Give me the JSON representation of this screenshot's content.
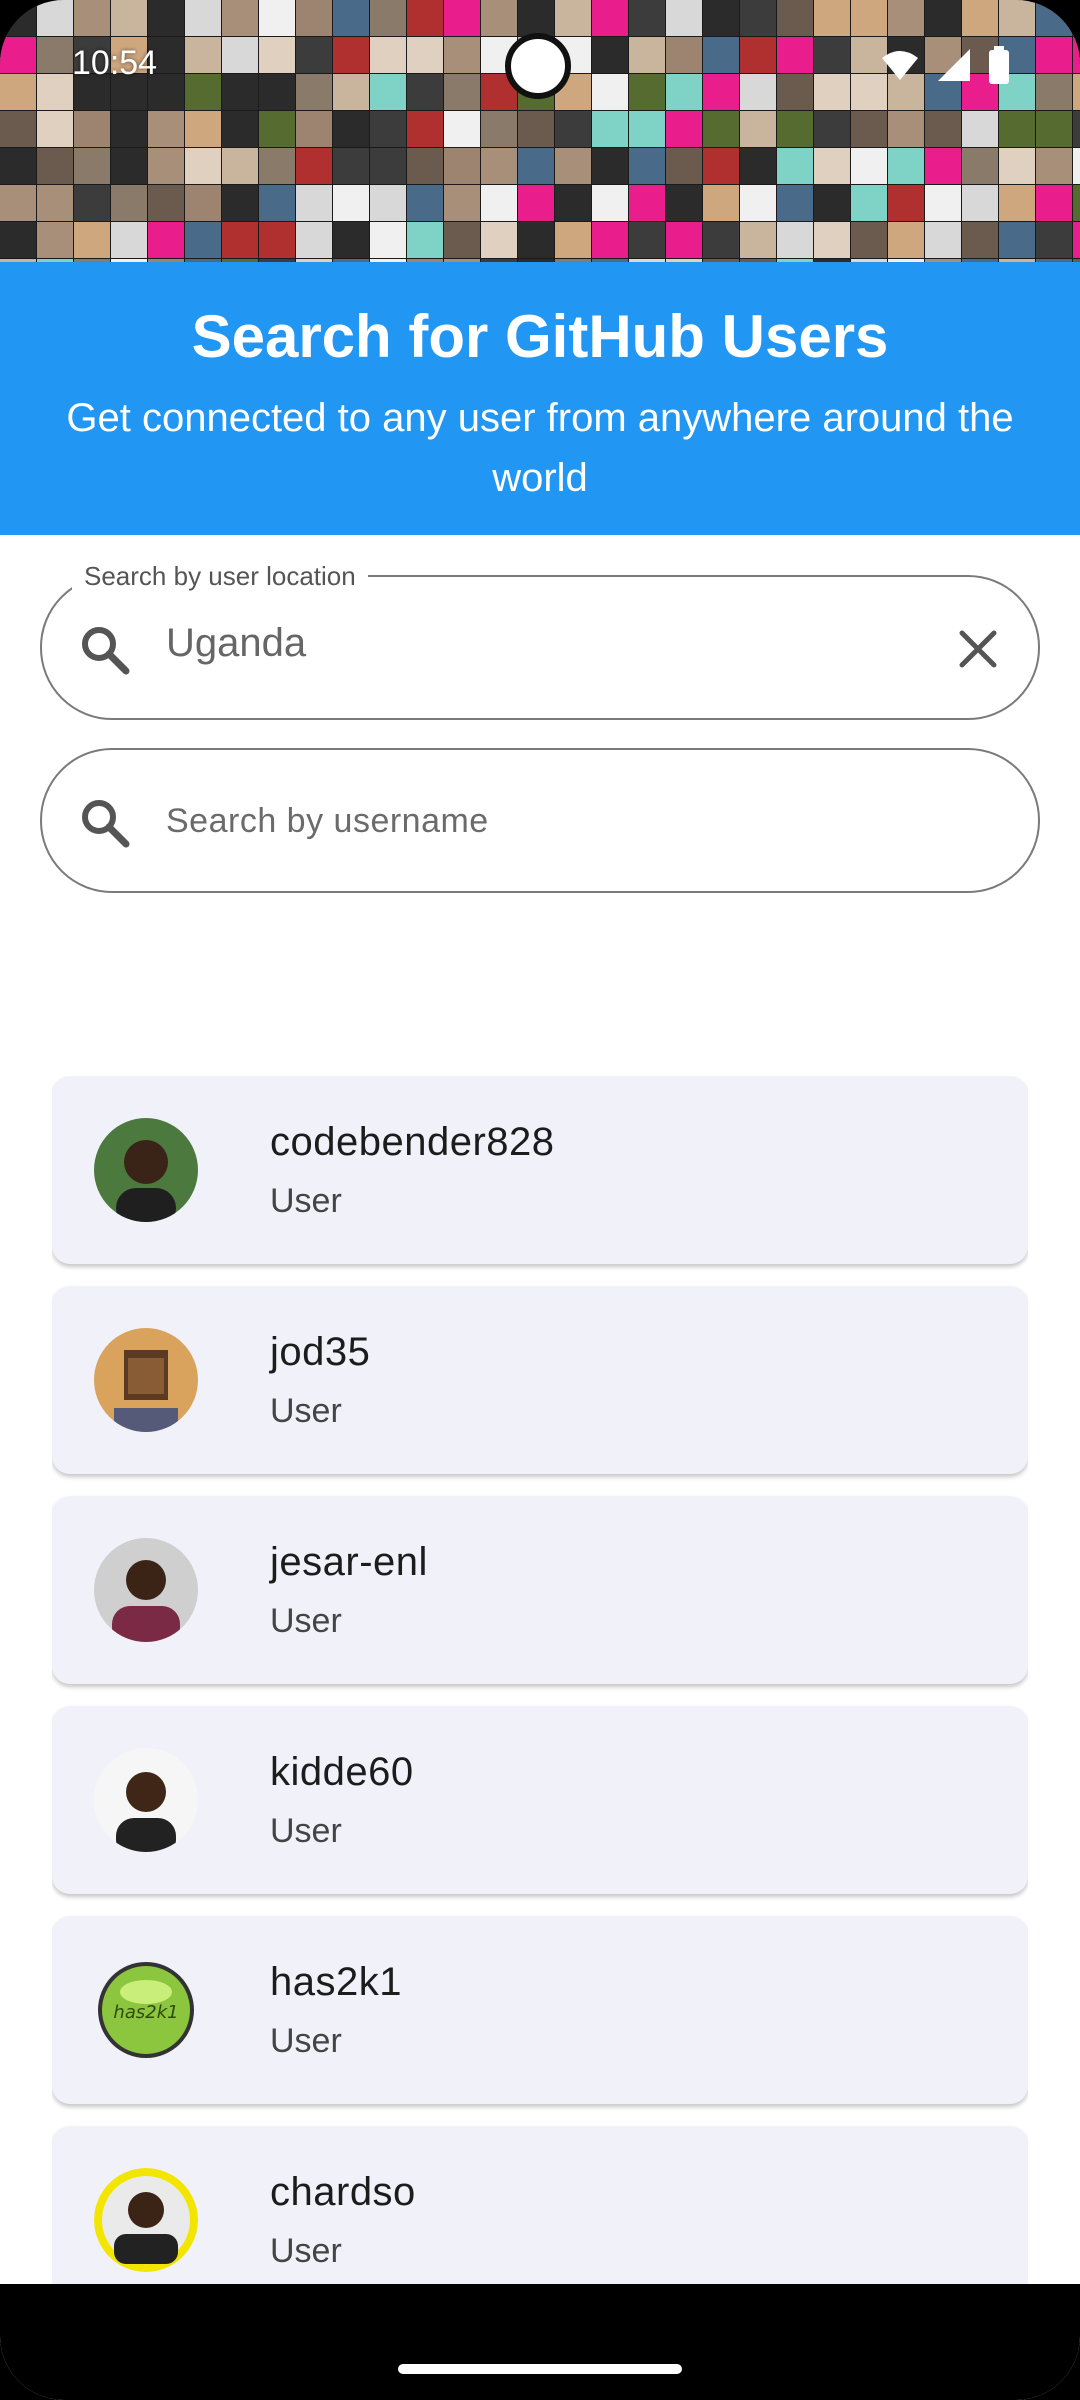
{
  "status_bar": {
    "time": "10:54",
    "icons": [
      "shield-icon",
      "wifi-icon",
      "signal-icon",
      "battery-icon"
    ]
  },
  "header": {
    "title": "Search for GitHub Users",
    "subtitle": "Get connected to any user from anywhere around the world",
    "background_color": "#2196F3"
  },
  "location_search": {
    "label": "Search by user location",
    "value": "Uganda",
    "icon": "search-icon",
    "clear_icon": "close-icon"
  },
  "username_search": {
    "placeholder": "Search by username",
    "icon": "search-icon"
  },
  "users": [
    {
      "username": "codebender828",
      "type": "User",
      "avatar_color": "#3f5e3a"
    },
    {
      "username": "jod35",
      "type": "User",
      "avatar_color": "#d9a35e"
    },
    {
      "username": "jesar-enl",
      "type": "User",
      "avatar_color": "#7a2a44"
    },
    {
      "username": "kidde60",
      "type": "User",
      "avatar_color": "#f2f2f2"
    },
    {
      "username": "has2k1",
      "type": "User",
      "avatar_color": "#8cc63f"
    },
    {
      "username": "chardso",
      "type": "User",
      "avatar_color": "#f2e600"
    }
  ]
}
